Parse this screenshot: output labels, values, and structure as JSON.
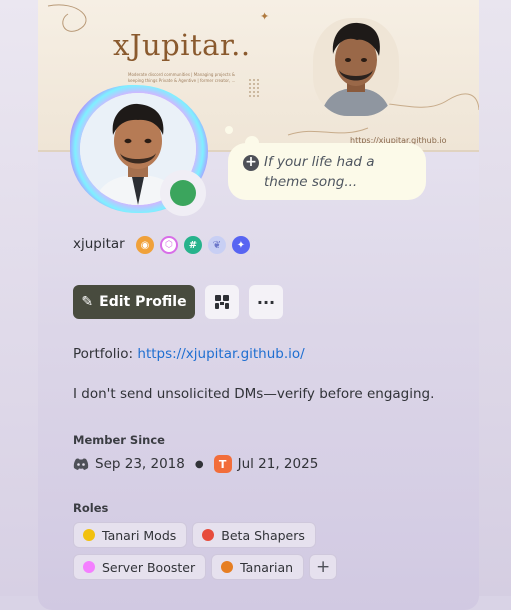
{
  "banner": {
    "title": "xJupitar..",
    "subtitle": "Moderate discord communities | Managing projects & keeping things Private & Agentive | former creator, ...",
    "url": "https://xjupitar.github.io"
  },
  "status_bubble": {
    "text": "If your life had a theme song..."
  },
  "profile": {
    "username": "xjupitar",
    "badges": [
      {
        "icon": "nitro-icon",
        "color": "#f0a13a"
      },
      {
        "icon": "hypesquad-icon",
        "color": "#d86ee8"
      },
      {
        "icon": "quest-icon",
        "color": "#27b38c"
      },
      {
        "icon": "laurel-icon",
        "color": "#9aa6e8"
      },
      {
        "icon": "active-developer-icon",
        "color": "#5865f2"
      }
    ]
  },
  "actions": {
    "edit_label": "Edit Profile",
    "more_label": "···"
  },
  "portfolio": {
    "label": "Portfolio:",
    "link": "https://xjupitar.github.io/"
  },
  "bio": "I don't send unsolicited DMs—verify before engaging.",
  "member_since": {
    "label": "Member Since",
    "discord_date": "Sep 23, 2018",
    "server_date": "Jul 21, 2025",
    "server_icon_letter": "T"
  },
  "roles": {
    "label": "Roles",
    "items": [
      {
        "name": "Tanari Mods",
        "color": "#f2c10f"
      },
      {
        "name": "Beta Shapers",
        "color": "#e74c3c"
      },
      {
        "name": "Server Booster",
        "color": "#f47fff"
      },
      {
        "name": "Tanarian",
        "color": "#e67e22"
      }
    ],
    "add_label": "+"
  },
  "colors": {
    "online": "#3ba55d",
    "edit_button": "#484b3e",
    "link": "#1f6fd1"
  }
}
